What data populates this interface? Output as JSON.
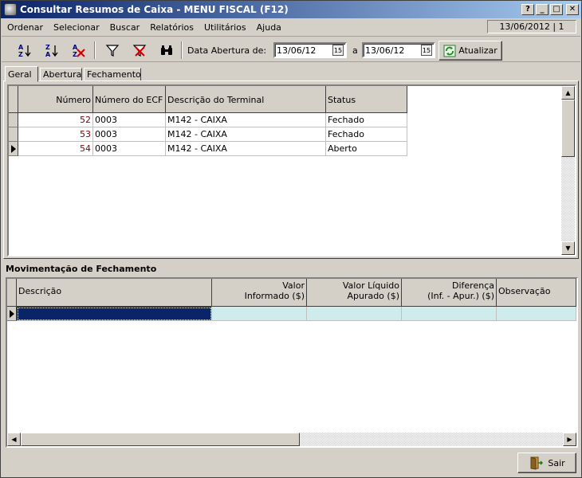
{
  "window": {
    "title": "Consultar Resumos de Caixa - MENU FISCAL (F12)",
    "help_label": "?",
    "min_label": "_",
    "max_label": "□",
    "close_label": "✕"
  },
  "menu": {
    "items": [
      "Ordenar",
      "Selecionar",
      "Buscar",
      "Relatórios",
      "Utilitários",
      "Ajuda"
    ]
  },
  "status_date": "13/06/2012 | 1",
  "toolbar": {
    "icons": [
      "sort-asc-icon",
      "sort-desc-icon",
      "clear-sort-icon",
      "filter-icon",
      "clear-filter-icon",
      "binoculars-icon"
    ],
    "date_label": "Data Abertura de:",
    "date_from": "13/06/12",
    "date_sep": "a",
    "date_to": "13/06/12",
    "calendar_label": "15",
    "refresh_label": "Atualizar"
  },
  "tabs": [
    "Geral",
    "Abertura",
    "Fechamento"
  ],
  "top_grid": {
    "columns": [
      "Número",
      "Número do ECF",
      "Descrição do Terminal",
      "Status"
    ],
    "rows": [
      {
        "numero": "52",
        "ecf": "0003",
        "descricao": "M142 - CAIXA",
        "status": "Fechado"
      },
      {
        "numero": "53",
        "ecf": "0003",
        "descricao": "M142 - CAIXA",
        "status": "Fechado"
      },
      {
        "numero": "54",
        "ecf": "0003",
        "descricao": "M142 - CAIXA",
        "status": "Aberto"
      }
    ]
  },
  "section_title": "Movimentação de Fechamento",
  "bottom_grid": {
    "columns": [
      {
        "l1": "",
        "l2": "Descrição"
      },
      {
        "l1": "Valor",
        "l2": "Informado ($)"
      },
      {
        "l1": "Valor Líquido",
        "l2": "Apurado ($)"
      },
      {
        "l1": "Diferença",
        "l2": "(Inf. - Apur.) ($)"
      },
      {
        "l1": "",
        "l2": "Observação"
      }
    ]
  },
  "exit_label": "Sair",
  "colors": {
    "title_start": "#0a246a",
    "title_end": "#a6caf0",
    "number_text": "#800000",
    "selected_cell": "#0a246a",
    "row_highlight": "#cfecec"
  }
}
